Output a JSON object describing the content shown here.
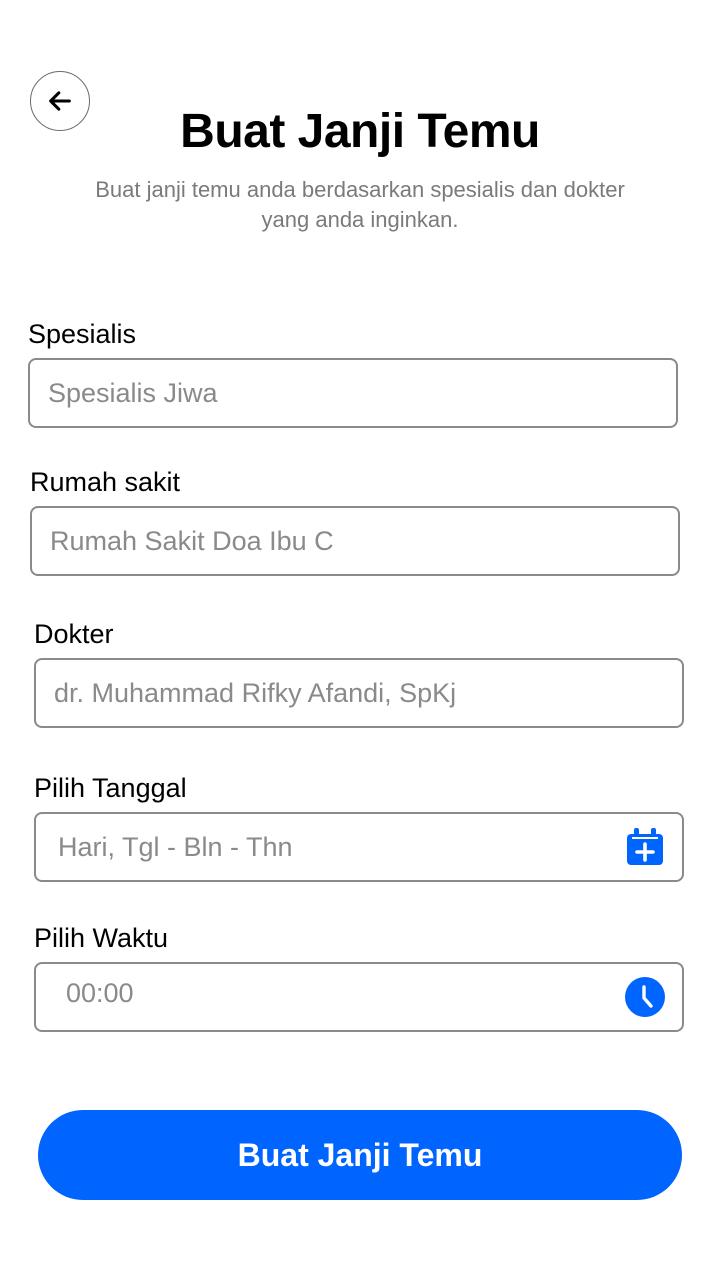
{
  "header": {
    "title": "Buat Janji Temu",
    "subtitle": "Buat janji temu anda berdasarkan spesialis dan dokter yang anda inginkan."
  },
  "form": {
    "specialist": {
      "label": "Spesialis",
      "placeholder": "Spesialis Jiwa"
    },
    "hospital": {
      "label": "Rumah sakit",
      "placeholder": "Rumah Sakit Doa Ibu C"
    },
    "doctor": {
      "label": "Dokter",
      "placeholder": "dr. Muhammad Rifky Afandi, SpKj"
    },
    "date": {
      "label": "Pilih Tanggal",
      "placeholder": "Hari, Tgl - Bln - Thn",
      "icon": "calendar-add-icon"
    },
    "time": {
      "label": "Pilih Waktu",
      "placeholder": "00:00",
      "icon": "clock-icon"
    }
  },
  "submit_label": "Buat Janji Temu",
  "colors": {
    "accent": "#0065ff",
    "border": "#8a8a8a",
    "placeholder": "#8a8a8a",
    "subtitle": "#7a7a7a"
  },
  "icons": {
    "back": "arrow-left-icon"
  }
}
